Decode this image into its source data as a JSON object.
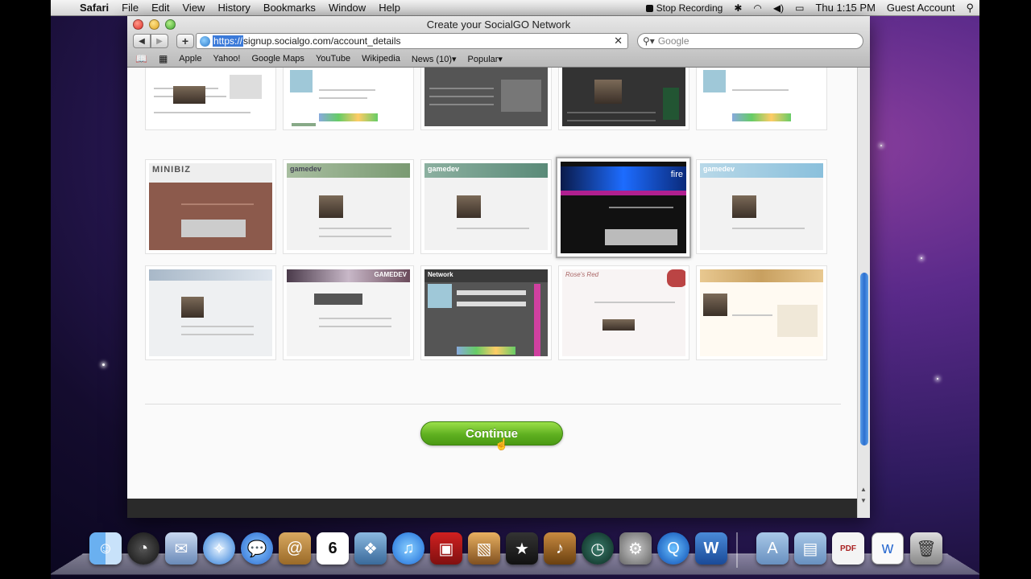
{
  "menubar": {
    "apple": "",
    "app": "Safari",
    "items": [
      "File",
      "Edit",
      "View",
      "History",
      "Bookmarks",
      "Window",
      "Help"
    ],
    "stop_recording": "Stop Recording",
    "clock": "Thu 1:15 PM",
    "user": "Guest Account"
  },
  "window": {
    "title": "Create your SocialGO Network",
    "url_protocol": "https://",
    "url_rest": "signup.socialgo.com/account_details",
    "search_placeholder": "Google",
    "bookmarks": [
      "Apple",
      "Yahoo!",
      "Google Maps",
      "YouTube",
      "Wikipedia",
      "News (10)▾",
      "Popular▾"
    ]
  },
  "themes": {
    "labels": [
      "MINIBIZ",
      "gamedev",
      "gamedev",
      "fire",
      "gamedev",
      "GAMEDEV",
      "Network",
      "Rose's Red"
    ],
    "selected_index": 8
  },
  "content": {
    "continue_label": "Continue"
  },
  "dock": {
    "icons": [
      "finder-icon",
      "dashboard-icon",
      "mail-icon",
      "safari-icon",
      "ichat-icon",
      "address-book-icon",
      "ical-icon",
      "iphoto-icon",
      "itunes-icon",
      "photo-booth-icon",
      "preview-icon",
      "imovie-icon",
      "garageband-icon",
      "time-machine-icon",
      "system-preferences-icon",
      "quicktime-icon",
      "word-icon",
      "applications-folder-icon",
      "documents-folder-icon",
      "pdf-icon",
      "document-icon",
      "trash-icon"
    ],
    "ical_date": "6"
  }
}
